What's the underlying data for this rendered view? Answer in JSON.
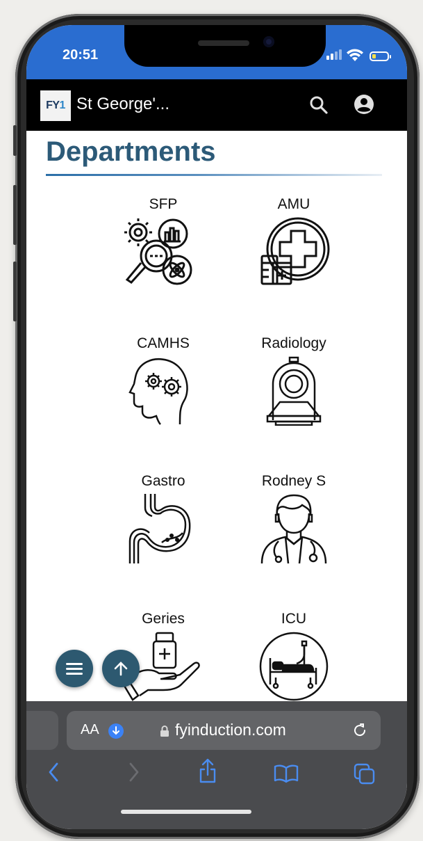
{
  "status_bar": {
    "time": "20:51",
    "icons": [
      "signal-icon",
      "wifi-icon",
      "battery-icon"
    ]
  },
  "app_bar": {
    "logo": {
      "prefix": "FY",
      "suffix": "1"
    },
    "title": "St George'...",
    "icons": [
      "search-icon",
      "account-icon"
    ]
  },
  "page": {
    "heading": "Departments"
  },
  "departments": [
    {
      "label": "SFP",
      "icon": "gears-magnifier-icon"
    },
    {
      "label": "AMU",
      "icon": "medical-cross-icon"
    },
    {
      "label": "CAMHS",
      "icon": "head-gears-icon"
    },
    {
      "label": "Radiology",
      "icon": "mri-scanner-icon"
    },
    {
      "label": "Gastro",
      "icon": "stomach-icon"
    },
    {
      "label": "Rodney S",
      "icon": "doctor-icon"
    },
    {
      "label": "Geries",
      "icon": "hand-medicine-icon"
    },
    {
      "label": "ICU",
      "icon": "hospital-bed-icon"
    }
  ],
  "fabs": {
    "menu": "menu-icon",
    "scroll_top": "arrow-up-icon"
  },
  "browser": {
    "text_size_label": "AA",
    "url": "fyinduction.com",
    "toolbar": [
      "back-icon",
      "forward-icon",
      "share-icon",
      "bookmarks-icon",
      "tabs-icon"
    ]
  },
  "colors": {
    "status_bar": "#2a6dd0",
    "heading": "#2c5a78",
    "fab": "#2d5970",
    "browser_accent": "#3b82f6"
  }
}
